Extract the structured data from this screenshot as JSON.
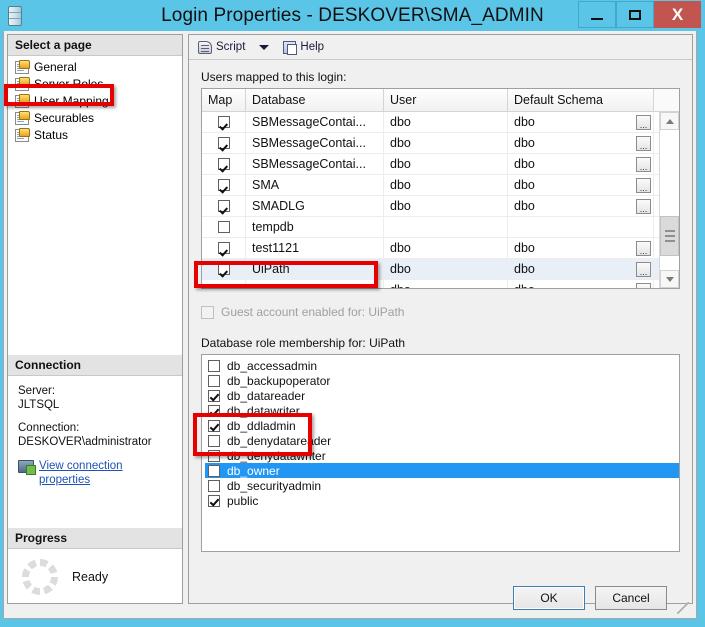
{
  "window": {
    "title": "Login Properties - DESKOVER\\SMA_ADMIN",
    "app_icon": "database-icon",
    "controls": {
      "minimize": "minimize-icon",
      "maximize": "maximize-icon",
      "close": "X"
    }
  },
  "sidebar": {
    "header": "Select a page",
    "items": [
      {
        "label": "General",
        "icon": "page-icon"
      },
      {
        "label": "Server Roles",
        "icon": "page-icon"
      },
      {
        "label": "User Mapping",
        "icon": "page-icon"
      },
      {
        "label": "Securables",
        "icon": "page-icon"
      },
      {
        "label": "Status",
        "icon": "page-icon"
      }
    ],
    "connection": {
      "header": "Connection",
      "server_label": "Server:",
      "server_value": "JLTSQL",
      "connection_label": "Connection:",
      "connection_value": "DESKOVER\\administrator",
      "link": "View connection properties",
      "link_icon": "connection-properties-icon"
    },
    "progress": {
      "header": "Progress",
      "status": "Ready",
      "spinner_icon": "progress-spinner-icon"
    }
  },
  "toolbar": {
    "script_label": "Script",
    "script_icon": "script-icon",
    "script_caret": "chevron-down-icon",
    "help_label": "Help",
    "help_icon": "help-icon"
  },
  "main": {
    "users_label": "Users mapped to this login:",
    "grid": {
      "columns": [
        "Map",
        "Database",
        "User",
        "Default Schema"
      ],
      "ellipsis_label": "...",
      "rows": [
        {
          "map": true,
          "database": "SBMessageContai...",
          "user": "dbo",
          "schema": "dbo",
          "selected": false
        },
        {
          "map": true,
          "database": "SBMessageContai...",
          "user": "dbo",
          "schema": "dbo",
          "selected": false
        },
        {
          "map": true,
          "database": "SBMessageContai...",
          "user": "dbo",
          "schema": "dbo",
          "selected": false
        },
        {
          "map": true,
          "database": "SMA",
          "user": "dbo",
          "schema": "dbo",
          "selected": false
        },
        {
          "map": true,
          "database": "SMADLG",
          "user": "dbo",
          "schema": "dbo",
          "selected": false
        },
        {
          "map": false,
          "database": "tempdb",
          "user": "",
          "schema": "",
          "selected": false
        },
        {
          "map": true,
          "database": "test1121",
          "user": "dbo",
          "schema": "dbo",
          "selected": false
        },
        {
          "map": true,
          "database": "UiPath",
          "user": "dbo",
          "schema": "dbo",
          "selected": true
        },
        {
          "map": true,
          "database": "UiPathPlatform",
          "user": "dbo",
          "schema": "dbo",
          "selected": false
        }
      ],
      "scrollbar": {
        "up_icon": "scroll-up-icon",
        "down_icon": "scroll-down-icon",
        "thumb": "scroll-thumb"
      }
    },
    "guest_account": {
      "label": "Guest account enabled for: UiPath",
      "checked": false,
      "enabled": false
    },
    "roles_label": "Database role membership for: UiPath",
    "roles": [
      {
        "label": "db_accessadmin",
        "checked": false,
        "selected": false
      },
      {
        "label": "db_backupoperator",
        "checked": false,
        "selected": false
      },
      {
        "label": "db_datareader",
        "checked": true,
        "selected": false
      },
      {
        "label": "db_datawriter",
        "checked": true,
        "selected": false
      },
      {
        "label": "db_ddladmin",
        "checked": true,
        "selected": false
      },
      {
        "label": "db_denydatareader",
        "checked": false,
        "selected": false
      },
      {
        "label": "db_denydatawriter",
        "checked": false,
        "selected": false
      },
      {
        "label": "db_owner",
        "checked": false,
        "selected": true
      },
      {
        "label": "db_securityadmin",
        "checked": false,
        "selected": false
      },
      {
        "label": "public",
        "checked": true,
        "selected": false
      }
    ]
  },
  "footer": {
    "ok": "OK",
    "cancel": "Cancel"
  },
  "annotations": [
    {
      "name": "redbox-usermapping",
      "target": "User Mapping"
    },
    {
      "name": "redbox-uipath",
      "target": "UiPath row"
    },
    {
      "name": "redbox-roles",
      "target": "db_datareader / db_datawriter / db_ddladmin"
    }
  ],
  "colors": {
    "titlebar": "#5BC5E8",
    "close_button": "#C25550",
    "selection": "#2196F3",
    "row_selection": "#E8EFF7",
    "annotation": "#E60000",
    "link": "#1E52B5"
  }
}
